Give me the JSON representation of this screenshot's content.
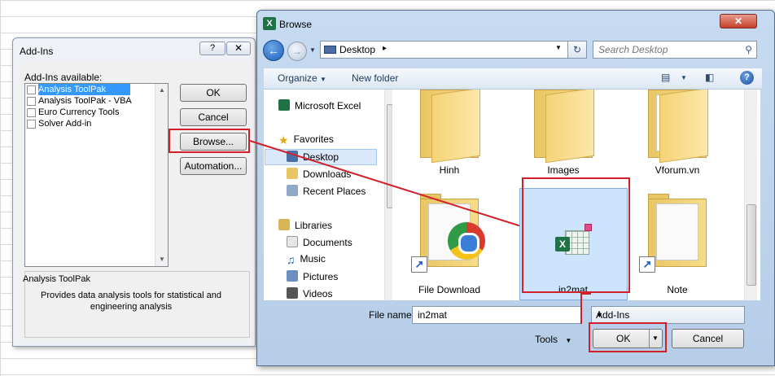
{
  "addins": {
    "title": "Add-Ins",
    "help_label": "?",
    "close_label": "✕",
    "available_label": "Add-Ins available:",
    "items": [
      {
        "label": "Analysis ToolPak",
        "selected": true
      },
      {
        "label": "Analysis ToolPak - VBA",
        "selected": false
      },
      {
        "label": "Euro Currency Tools",
        "selected": false
      },
      {
        "label": "Solver Add-in",
        "selected": false
      }
    ],
    "buttons": {
      "ok": "OK",
      "cancel": "Cancel",
      "browse": "Browse...",
      "automation": "Automation..."
    },
    "description_title": "Analysis ToolPak",
    "description_text": "Provides data analysis tools for statistical and engineering analysis"
  },
  "browse": {
    "title": "Browse",
    "close_label": "✕",
    "address": "Desktop",
    "search_placeholder": "Search Desktop",
    "toolbar": {
      "organize": "Organize",
      "new_folder": "New folder"
    },
    "nav": [
      {
        "label": "Microsoft Excel",
        "icon": "excel-icon"
      },
      {
        "label": "Favorites",
        "icon": "star-icon"
      },
      {
        "label": "Desktop",
        "icon": "desktop-icon",
        "selected": true
      },
      {
        "label": "Downloads",
        "icon": "downloads-folder-icon"
      },
      {
        "label": "Recent Places",
        "icon": "recent-places-icon"
      },
      {
        "label": "Libraries",
        "icon": "libraries-icon"
      },
      {
        "label": "Documents",
        "icon": "documents-icon"
      },
      {
        "label": "Music",
        "icon": "music-icon"
      },
      {
        "label": "Pictures",
        "icon": "pictures-icon"
      },
      {
        "label": "Videos",
        "icon": "videos-icon"
      }
    ],
    "files": [
      {
        "label": "Hinh"
      },
      {
        "label": "Images"
      },
      {
        "label": "Vforum.vn"
      },
      {
        "label": "File Download"
      },
      {
        "label": "in2mat",
        "selected": true
      },
      {
        "label": "Note"
      }
    ],
    "file_name_label": "File name:",
    "file_name_value": "in2mat",
    "file_type": "Add-Ins",
    "tools_label": "Tools",
    "ok_label": "OK",
    "cancel_label": "Cancel"
  },
  "colors": {
    "highlight_red": "#d0202a",
    "selection_blue": "#3399ff",
    "excel_green": "#1f7244"
  }
}
